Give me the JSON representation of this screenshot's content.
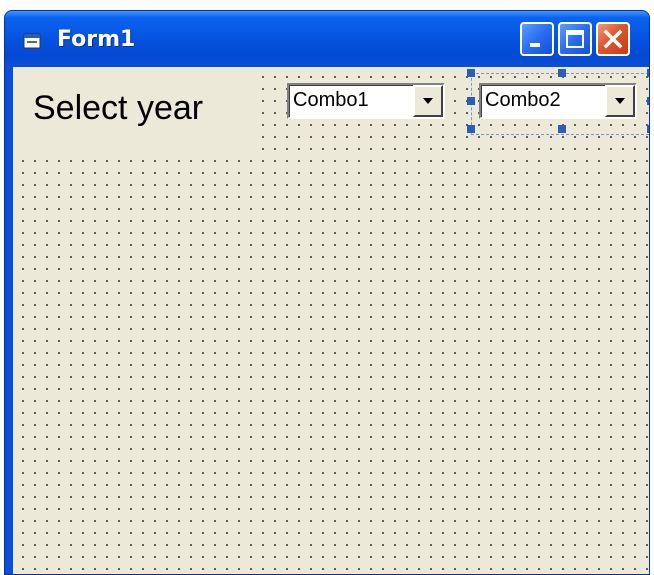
{
  "window": {
    "title": "Form1",
    "title_icon": "form-icon",
    "controls": {
      "minimize_icon": "minimize-icon",
      "maximize_icon": "maximize-icon",
      "close_icon": "close-icon"
    },
    "colors": {
      "titlebar": "#0553e0",
      "client": "#ece9d8",
      "close": "#e0552e",
      "selection_handle": "#2a5fb8"
    }
  },
  "form": {
    "label": "Select year",
    "combo1": {
      "value": "Combo1",
      "icon": "chevron-down-icon"
    },
    "combo2": {
      "value": "Combo2",
      "icon": "chevron-down-icon",
      "selected": true
    }
  }
}
